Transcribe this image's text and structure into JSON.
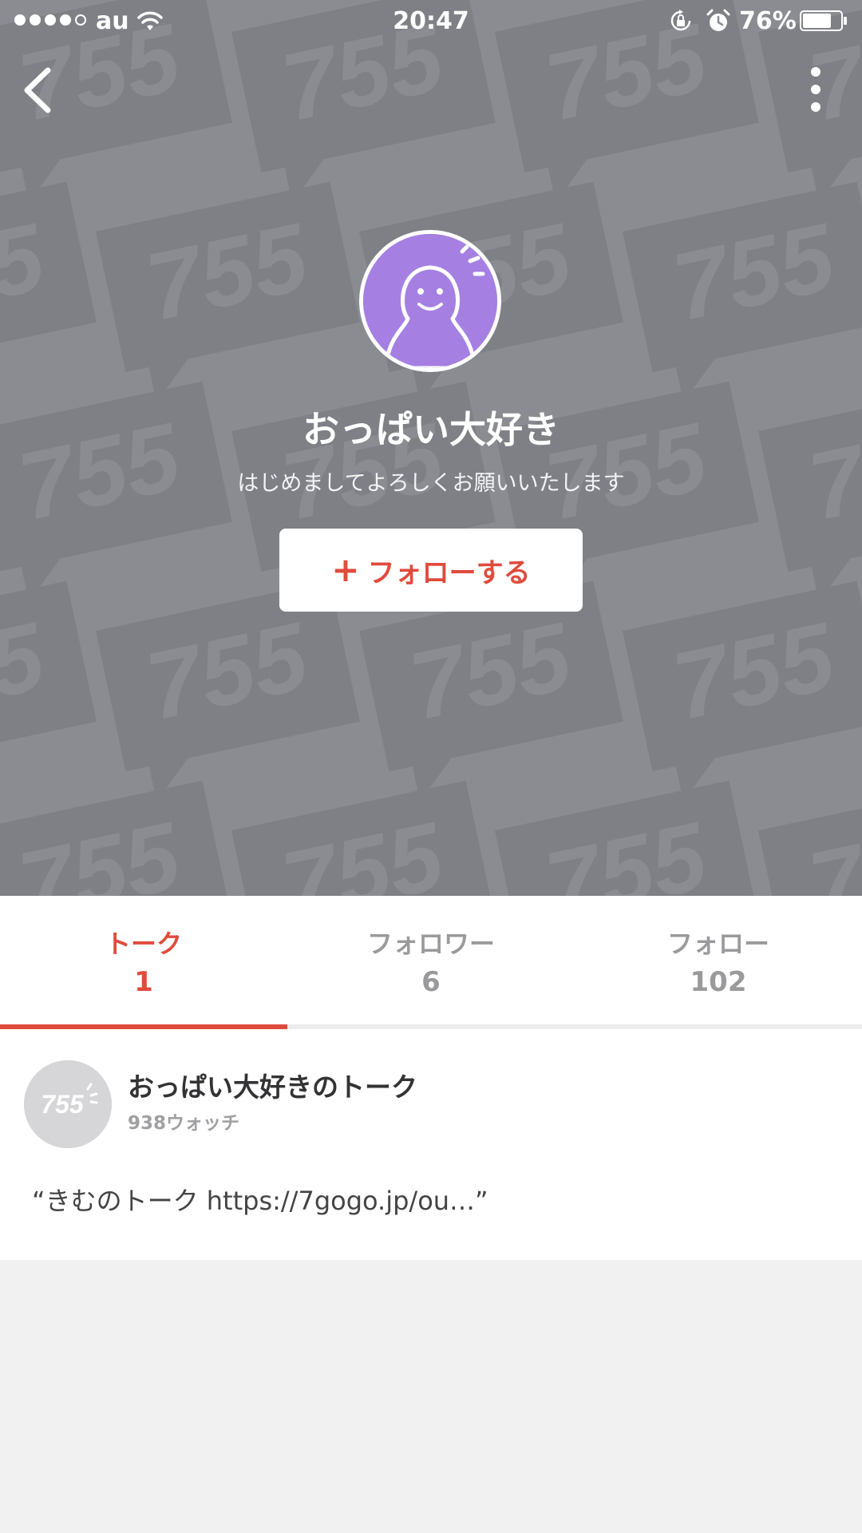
{
  "status_bar": {
    "carrier": "au",
    "time": "20:47",
    "battery_percent": "76%",
    "battery_level": 0.76,
    "signal_bars_filled": 4,
    "signal_bars_total": 5,
    "icons": [
      "wifi-icon",
      "rotation-lock-icon",
      "alarm-icon",
      "battery-icon"
    ]
  },
  "nav": {
    "back_icon": "chevron-left-icon",
    "more_icon": "vertical-ellipsis-icon"
  },
  "profile": {
    "name": "おっぱい大好き",
    "bio": "はじめましてよろしくお願いいたします",
    "follow_button_label": "フォローする",
    "follow_icon": "plus-icon",
    "avatar_color": "#a580e2"
  },
  "tabs": [
    {
      "label": "トーク",
      "count": "1",
      "active": true
    },
    {
      "label": "フォロワー",
      "count": "6",
      "active": false
    },
    {
      "label": "フォロー",
      "count": "102",
      "active": false
    }
  ],
  "talk": {
    "title": "おっぱい大好きのトーク",
    "watch_count": "938ウォッチ",
    "quote": "“きむのトーク https://7gogo.jp/ou…”",
    "thumb_logo_text": "755"
  },
  "hero": {
    "pattern_text": "755"
  },
  "colors": {
    "accent": "#e04b3c",
    "hero_background": "#8a8c91",
    "pattern_tile": "#7e8085",
    "page_background": "#f1f1f2"
  }
}
